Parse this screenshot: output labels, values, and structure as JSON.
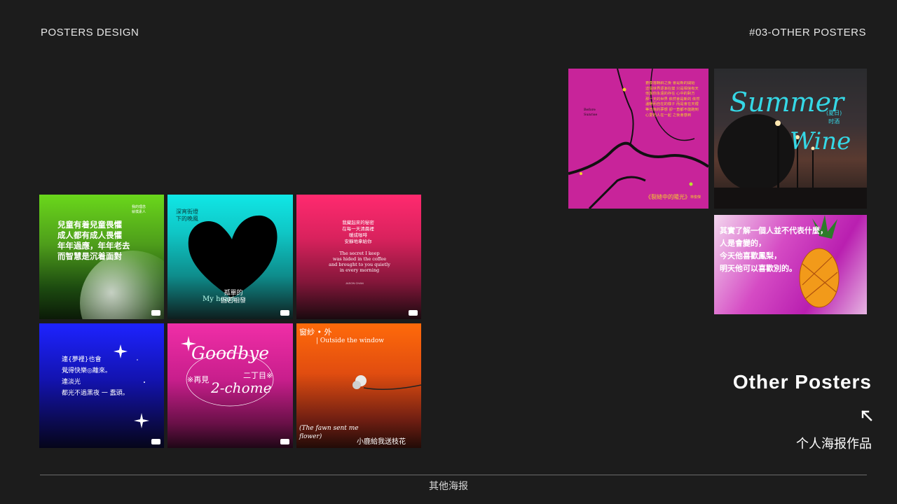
{
  "header": {
    "left": "POSTERS DESIGN",
    "right": "#03-OTHER POSTERS"
  },
  "posters": {
    "p1": {
      "main": "兒童有着兒童畏懼\n成人都有成人畏懼\n年年過應，年年老去\n而智慧是沉着面對",
      "corner": "我的理念\n就樸素人"
    },
    "p2": {
      "top": "深宵街燈\n下的晚風",
      "bottom": "孤單的\n固若相發",
      "script": "My heart"
    },
    "p3": {
      "cn": "我藏起來的秘密\n在每一天清晨裡\n暖成咖啡\n安靜地拿給你",
      "en": "The secret I keep\nwas hided in the coffee\nand brought to you quietly\nin every morning",
      "credit": "JASON CHAN"
    },
    "p4": {
      "main": "連{夢裡}也會\n覺得快樂◎離來。\n連淡光\n都光不過黑夜 一 蠢頭。"
    },
    "p5": {
      "script1": "Goodbye",
      "cn1": "二丁目※",
      "cn2": "※再見",
      "script2": "2-chome"
    },
    "p6": {
      "title": "窗紗 • 外",
      "en": "| Outside the window",
      "bottom_en": "(The fawn sent me\nflower)",
      "bottom_cn": "小鹿給我送枝花"
    },
    "p7": {
      "left": "Before\nSunrise",
      "body": "蒼樹落轉斜之後 會是新的開始\n這個世界逐漸在變 只是相信有天\n他與你永遠的存在 心中的對方\n那一天的世界 依然會是新的 依然\n溫暖而自在的樣子 而是會在天裡\n等日後的夢想 卻一直都不能跑到\n心愛的人在一起 之後會感到",
      "title": "《裂縫中的陽光》",
      "author": "林俊傑"
    },
    "p8": {
      "script": "Summer",
      "script2": "Wine",
      "cn": "(夏日)\n时酒"
    },
    "p9": {
      "cn": "其實了解一個人並不代表什麼，\n人是會變的，\n今天他喜歡鳳梨，\n明天他可以喜歡別的。"
    }
  },
  "section": {
    "title": "Other Posters",
    "subtitle": "个人海报作品",
    "arrow_icon": "arrow-up-left-icon"
  },
  "footer": {
    "label": "其他海报"
  }
}
